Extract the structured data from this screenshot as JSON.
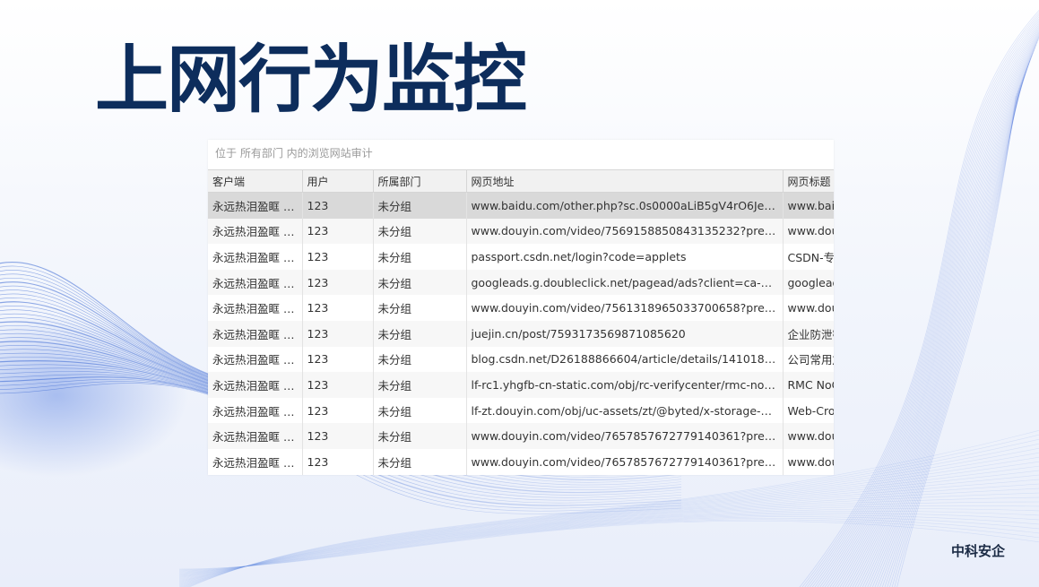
{
  "title": "上网行为监控",
  "caption": "位于 所有部门 内的浏览网站审计",
  "columns": [
    "客户端",
    "用户",
    "所属部门",
    "网页地址",
    "网页标题"
  ],
  "rows": [
    {
      "client": "永远热泪盈眶 (1...",
      "user": "123",
      "dept": "未分组",
      "url": "www.baidu.com/other.php?sc.0s0000aLiB5gV4rO6JeZSBTL...",
      "page_title": "www.baidu",
      "selected": true
    },
    {
      "client": "永远热泪盈眶 (1...",
      "user": "123",
      "dept": "未分组",
      "url": "www.douyin.com/video/7569158850843135232?previous_...",
      "page_title": "www.douy"
    },
    {
      "client": "永远热泪盈眶 (1...",
      "user": "123",
      "dept": "未分组",
      "url": "passport.csdn.net/login?code=applets",
      "page_title": "CSDN-专业"
    },
    {
      "client": "永远热泪盈眶 (1...",
      "user": "123",
      "dept": "未分组",
      "url": "googleads.g.doubleclick.net/pagead/ads?client=ca-pub-...",
      "page_title": "googleads"
    },
    {
      "client": "永远热泪盈眶 (1...",
      "user": "123",
      "dept": "未分组",
      "url": "www.douyin.com/video/7561318965033700658?previous_...",
      "page_title": "www.douy"
    },
    {
      "client": "永远热泪盈眶 (1...",
      "user": "123",
      "dept": "未分组",
      "url": "juejin.cn/post/7593173569871085620",
      "page_title": "企业防泄密"
    },
    {
      "client": "永远热泪盈眶 (1...",
      "user": "123",
      "dept": "未分组",
      "url": "blog.csdn.net/D26188866604/article/details/141018946",
      "page_title": "公司常用加"
    },
    {
      "client": "永远热泪盈眶 (1...",
      "user": "123",
      "dept": "未分组",
      "url": "lf-rc1.yhgfb-cn-static.com/obj/rc-verifycenter/rmc-nocapt...",
      "page_title": "RMC NoC"
    },
    {
      "client": "永远热泪盈眶 (1...",
      "user": "123",
      "dept": "未分组",
      "url": "lf-zt.douyin.com/obj/uc-assets/zt/@byted/x-storage-web...",
      "page_title": "Web-Cros"
    },
    {
      "client": "永远热泪盈眶 (1...",
      "user": "123",
      "dept": "未分组",
      "url": "www.douyin.com/video/7657857672779140361?previous_...",
      "page_title": "www.douy"
    },
    {
      "client": "永远热泪盈眶 (1...",
      "user": "123",
      "dept": "未分组",
      "url": "www.douyin.com/video/7657857672779140361?previous_...",
      "page_title": "www.douy"
    }
  ],
  "brand": "中科安企",
  "colors": {
    "title": "#0d2d5c",
    "selected_row": "#d9d9d9",
    "wave": "#3f6fd8"
  }
}
